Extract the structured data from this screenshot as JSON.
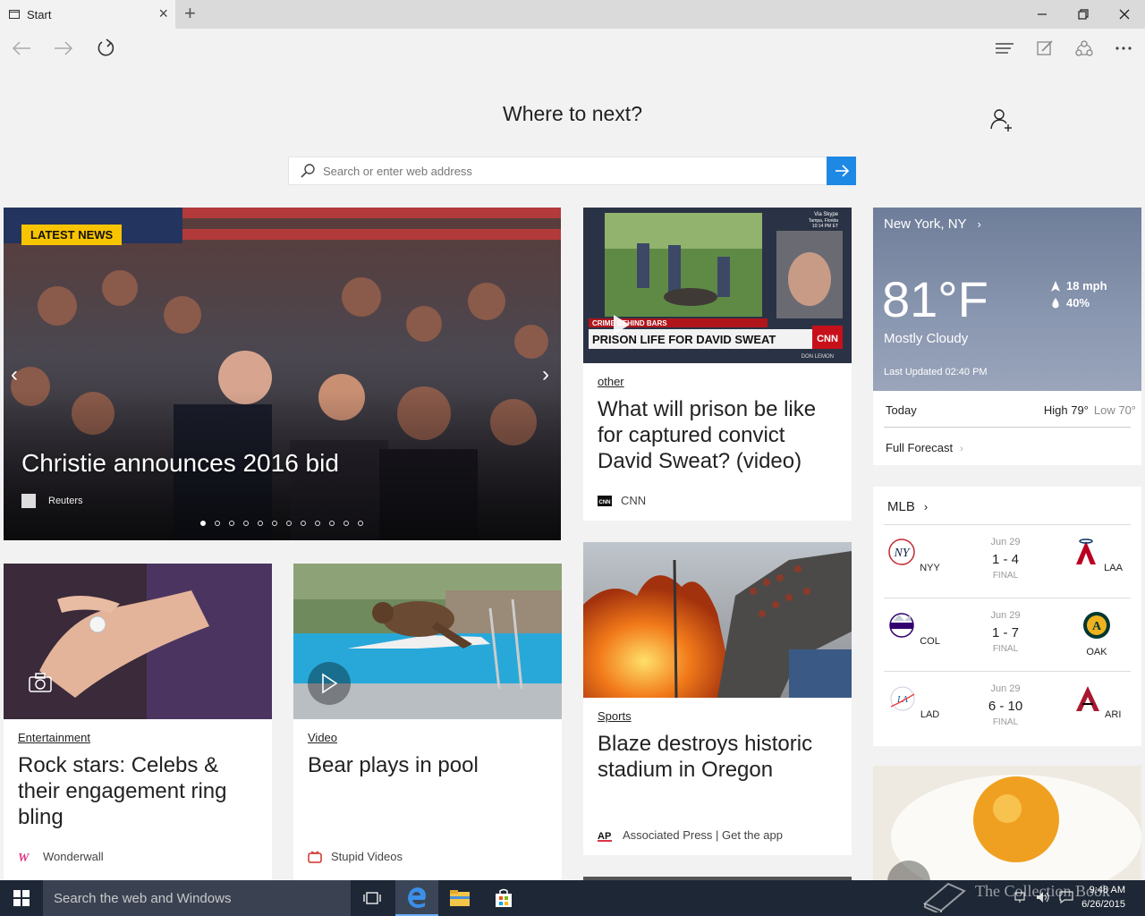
{
  "browser": {
    "tab_title": "Start",
    "new_tab_symbol": "+"
  },
  "start": {
    "heading": "Where to next?",
    "search_placeholder": "Search or enter web address"
  },
  "hero": {
    "badge": "LATEST NEWS",
    "title": "Christie announces 2016 bid",
    "source": "Reuters",
    "dots_total": 12,
    "dots_active": 1
  },
  "cards": {
    "prison": {
      "category": "other",
      "title": "What will prison be like for captured convict David Sweat? (video)",
      "source": "CNN",
      "chyron_top": "CRIME BEHIND BARS",
      "chyron_main": "PRISON LIFE FOR DAVID SWEAT",
      "chyron_anchor": "DON LEMON",
      "skype_label": "Via Skype",
      "skype_loc": "Tampa, Florida",
      "skype_time": "10:14 PM ET",
      "brand": "CNN"
    },
    "ring": {
      "category": "Entertainment",
      "title": "Rock stars: Celebs & their engagement ring bling",
      "source": "Wonderwall"
    },
    "bear": {
      "category": "Video",
      "title": "Bear plays in pool",
      "source": "Stupid Videos"
    },
    "blaze": {
      "category": "Sports",
      "title": "Blaze destroys historic stadium in Oregon",
      "source": "Associated Press | Get the app",
      "logo_text": "AP"
    }
  },
  "weather": {
    "location": "New York, NY",
    "temp": "81°F",
    "condition": "Mostly Cloudy",
    "wind": "18 mph",
    "precip": "40%",
    "updated": "Last Updated 02:40 PM",
    "today_label": "Today",
    "high": "High 79°",
    "low": "Low 70°",
    "full_forecast": "Full Forecast"
  },
  "mlb": {
    "title": "MLB",
    "games": [
      {
        "home": "NYY",
        "away": "LAA",
        "date": "Jun 29",
        "score": "1 - 4",
        "status": "FINAL"
      },
      {
        "home": "COL",
        "away": "OAK",
        "date": "Jun 29",
        "score": "1 - 7",
        "status": "FINAL"
      },
      {
        "home": "LAD",
        "away": "ARI",
        "date": "Jun 29",
        "score": "6 - 10",
        "status": "FINAL"
      }
    ]
  },
  "taskbar": {
    "search_text": "Search the web and Windows",
    "time": "9:48 AM",
    "date": "6/26/2015"
  },
  "watermark": "The Collection Book",
  "colors": {
    "accent_blue": "#1e88e5",
    "badge_yellow": "#f8c400",
    "taskbar": "#1e2735"
  }
}
